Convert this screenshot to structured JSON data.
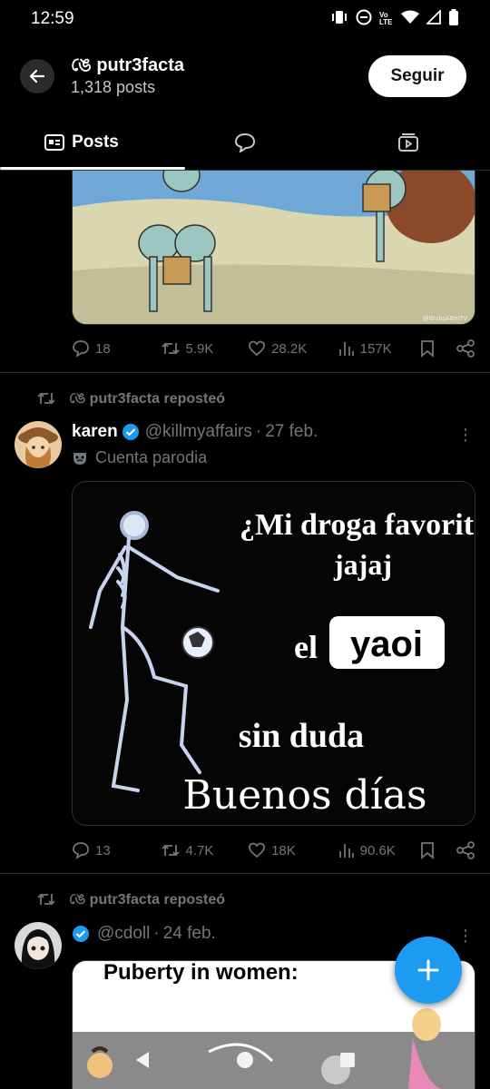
{
  "status_bar": {
    "time": "12:59",
    "volte": "Vo LTE"
  },
  "header": {
    "account_name": "ঙে putr3facta",
    "post_count": "1,318 posts",
    "follow_label": "Seguir"
  },
  "tabs": [
    {
      "label": "Posts",
      "active": true
    },
    {
      "label": "",
      "icon": "reply-bubble-icon"
    },
    {
      "label": "",
      "icon": "media-icon"
    }
  ],
  "post1": {
    "actions": {
      "replies": "18",
      "reposts": "5.9K",
      "likes": "28.2K",
      "views": "157K"
    },
    "media_caption": "@BruhsAReiTV"
  },
  "post2": {
    "repost_label": "ঙে putr3facta reposteó",
    "author_name": "karen",
    "handle": "@killmyaffairs",
    "date": "27 feb.",
    "parody_label": "Cuenta parodia",
    "image_text": {
      "line1": "¿Mi droga favorita?",
      "line2": "jajaj",
      "line3_el": "el",
      "line3_yaoi": "yaoi",
      "line4": "sin duda",
      "line5": "Buenos días"
    },
    "actions": {
      "replies": "13",
      "reposts": "4.7K",
      "likes": "18K",
      "views": "90.6K"
    }
  },
  "post3": {
    "repost_label": "ঙে putr3facta reposteó",
    "handle": "@cdoll",
    "date": "24 feb.",
    "image_text": "Puberty in women:"
  },
  "colors": {
    "accent": "#1d9bf0",
    "muted": "#71767b",
    "background": "#000000"
  }
}
